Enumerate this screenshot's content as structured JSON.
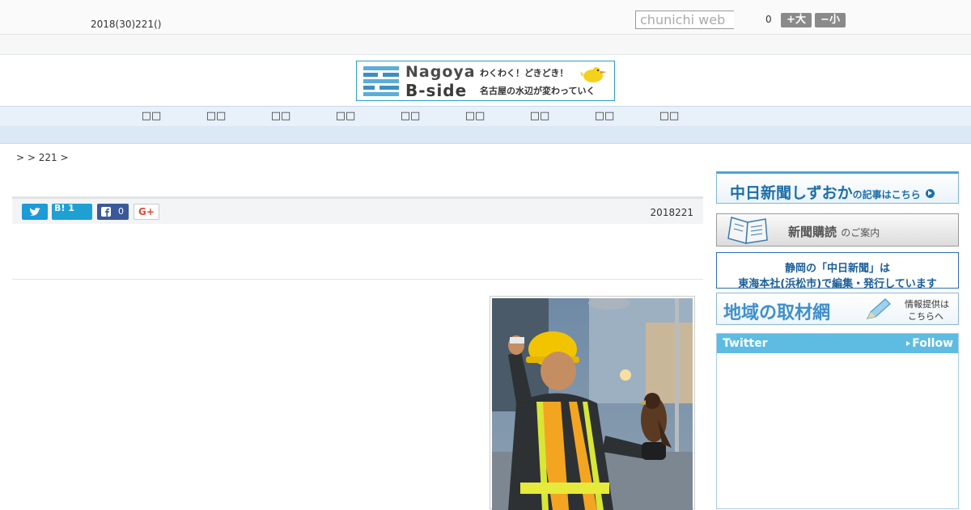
{
  "header": {
    "date": "2018(30)221()",
    "search_placeholder": "chunichi web",
    "font_size_value": "0",
    "font_larger_label": "+大",
    "font_smaller_label": "−小"
  },
  "banner": {
    "title_line1": "Nagoya",
    "title_line2": "B-side",
    "subtitle_line1": "わくわく！どきどき！",
    "subtitle_line2": "名古屋の水辺が変わっていく"
  },
  "nav": {
    "items": [
      "□□",
      "□□",
      "□□",
      "□□",
      "□□",
      "□□",
      "□□",
      "□□",
      "□□"
    ]
  },
  "breadcrumb": ">  > 221 >",
  "article": {
    "date": "2018221",
    "share": {
      "hatena_label": "B!",
      "hatena_count": "1",
      "facebook_count": "0",
      "gplus_label": "G+"
    },
    "photo_alt": "Worker in hard hat and safety vest with hawk on gloved hand"
  },
  "sidebar": {
    "shizuoka_main": "中日新聞しずおか",
    "shizuoka_small": "の記事はこちら",
    "subscribe_main": "新聞購読",
    "subscribe_small": "のご案内",
    "info_line1": "静岡の「中日新聞」は",
    "info_line2": "東海本社(浜松市)で編集・発行しています",
    "tips_main": "地域の取材網",
    "tips_line1": "情報提供は",
    "tips_line2": "こちらへ",
    "twitter_label": "Twitter",
    "follow_label": "Follow"
  },
  "colors": {
    "nav_bg": "#e8f1fa",
    "accent_blue": "#1d6ea8",
    "twitter_head": "#5ebce3"
  }
}
